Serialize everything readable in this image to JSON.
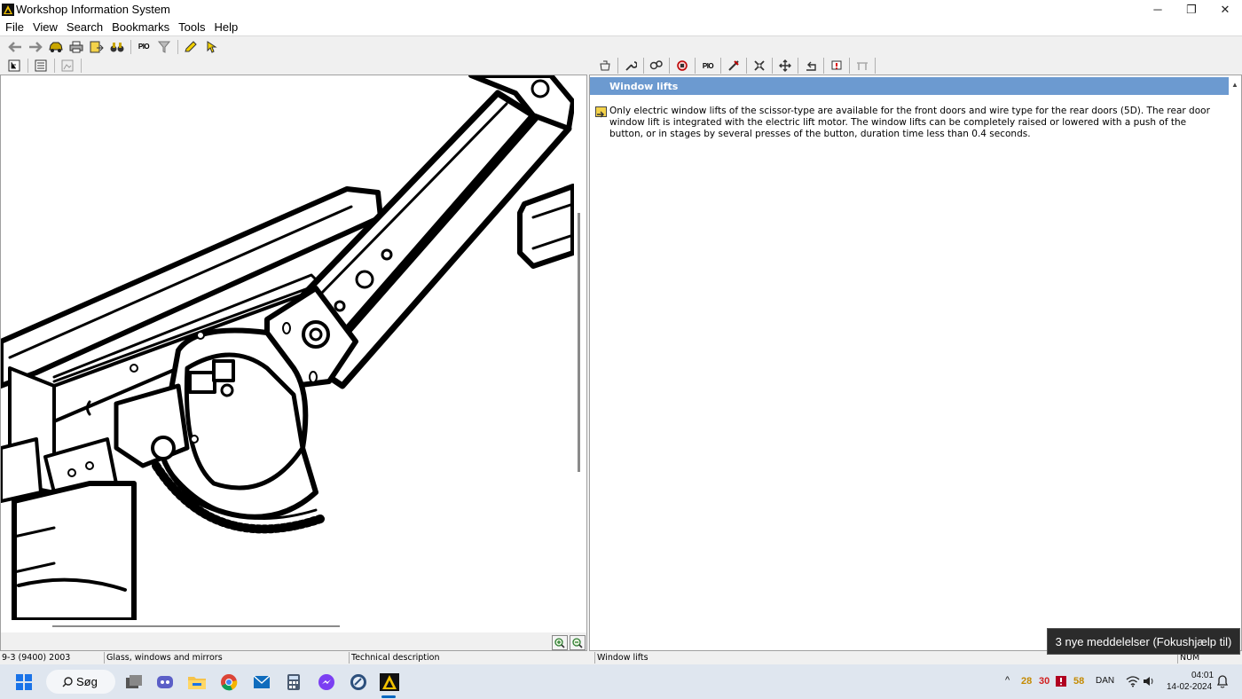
{
  "window": {
    "title": "Workshop Information System",
    "controls": {
      "minimize": "─",
      "maximize": "❐",
      "close": "✕"
    }
  },
  "menu": [
    "File",
    "View",
    "Search",
    "Bookmarks",
    "Tools",
    "Help"
  ],
  "toolbar": {
    "icons": [
      "back-arrow-icon",
      "forward-arrow-icon",
      "car-icon",
      "print-icon",
      "export-icon",
      "binoculars-icon",
      "pio-icon",
      "filter-icon",
      "pencil-icon",
      "pointer-icon"
    ],
    "pio_label": "PIO"
  },
  "right_toolbar": {
    "pio_label": "PIO",
    "icons": [
      "engine-icon",
      "wrench-icon",
      "gears-icon",
      "circle-icon",
      "pio-icon",
      "tool-icon",
      "settings-icon",
      "move-icon",
      "return-icon",
      "alert-icon",
      "car-lift-icon"
    ]
  },
  "document": {
    "header": "Window lifts",
    "body": "Only electric window lifts of the scissor-type are available for the front doors and wire type for the rear doors (5D). The rear door window lift is integrated with the electric lift motor. The window lifts can be completely raised or lowered with a push of the button, or in stages by several presses of the button, duration time less than 0.4 seconds."
  },
  "status": {
    "model": "9-3 (9400) 2003",
    "section": "Glass, windows and mirrors",
    "doc_type": "Technical description",
    "topic": "Window lifts",
    "num": "NUM"
  },
  "toast": {
    "text": "3 nye meddelelser (Fokushjælp til)"
  },
  "taskbar": {
    "search_label": "Søg",
    "tray_numbers": [
      {
        "value": "28",
        "color": "#c48a00"
      },
      {
        "value": "30",
        "color": "#d11f1f"
      },
      {
        "value": "58",
        "color": "#c48a00"
      }
    ],
    "lang": "DAN",
    "time": "04:01",
    "date": "14-02-2024"
  }
}
